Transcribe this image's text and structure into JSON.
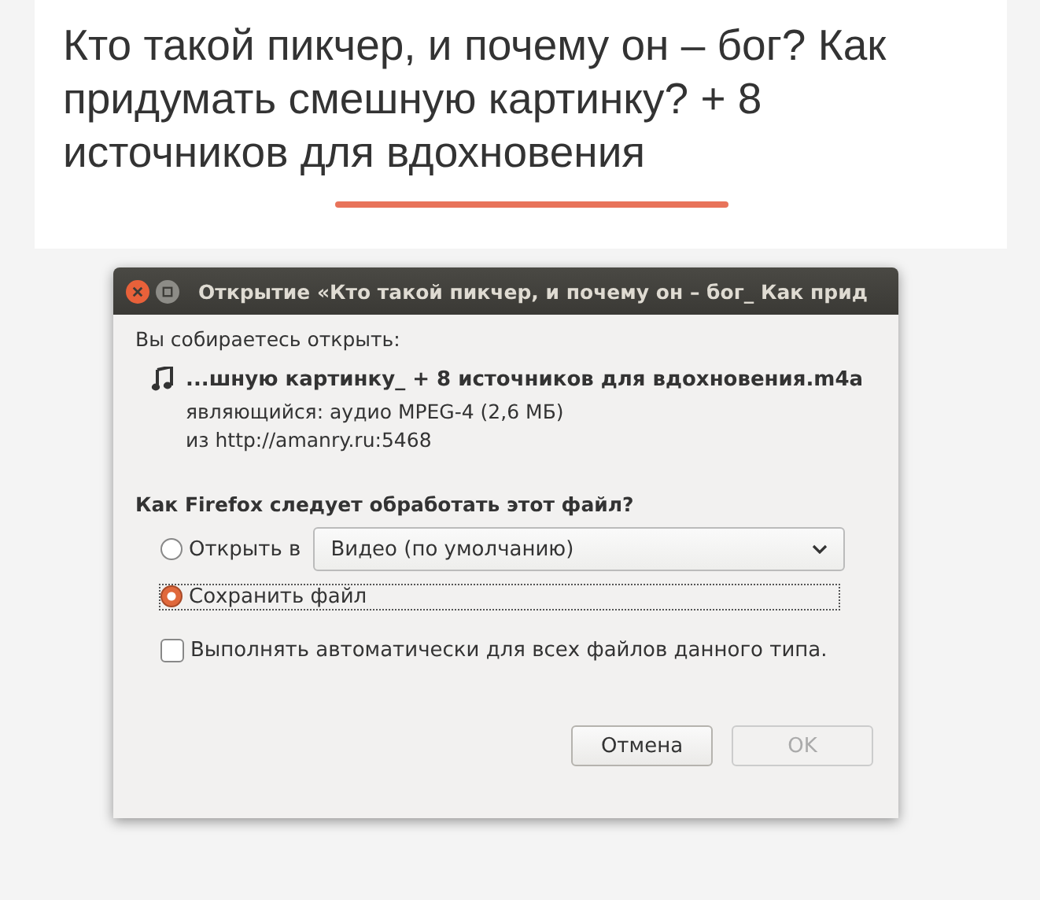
{
  "article": {
    "title": "Кто такой пикчер, и почему он – бог? Как придумать смешную картинку? + 8 источников для вдохновения"
  },
  "dialog": {
    "title": "Открытие «Кто такой пикчер, и почему он – бог_ Как прид",
    "intro": "Вы собираетесь открыть:",
    "file_name": "...шную картинку_ + 8 источников для вдохновения.m4a",
    "file_type": "являющийся:  аудио MPEG-4 (2,6 МБ)",
    "source": "из http://amanry.ru:5468",
    "question": "Как Firefox следует обработать этот файл?",
    "options": [
      {
        "label": "Открыть в",
        "selected": false,
        "app": "Видео (по умолчанию)"
      },
      {
        "label": "Сохранить файл",
        "selected": true
      }
    ],
    "auto_checkbox": {
      "label": "Выполнять автоматически для всех файлов данного типа.",
      "checked": false
    },
    "buttons": [
      {
        "label": "Отмена",
        "disabled": false
      },
      {
        "label": "OK",
        "disabled": true
      }
    ]
  }
}
